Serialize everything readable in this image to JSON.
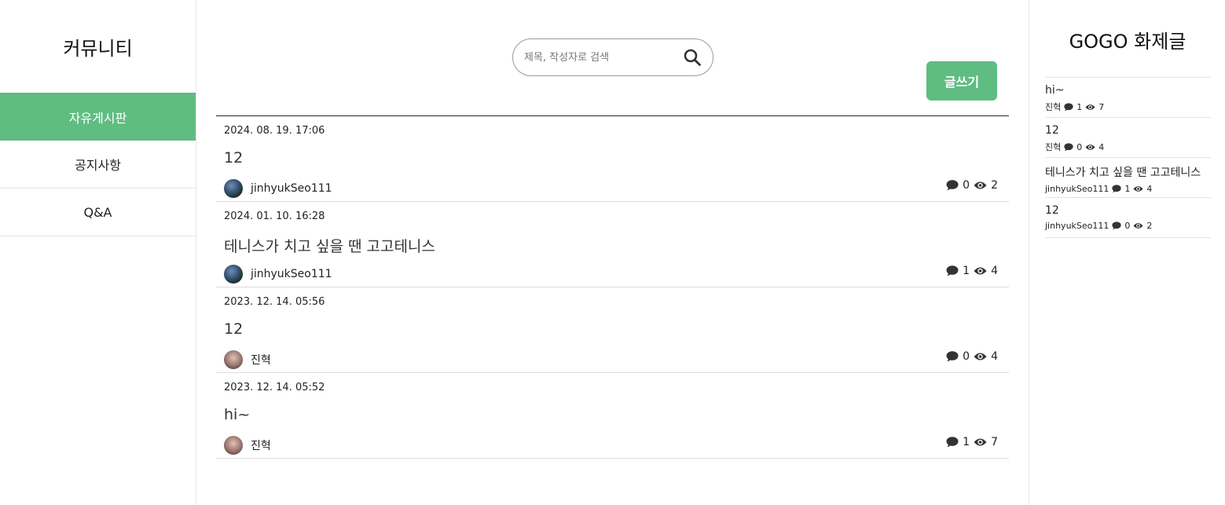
{
  "sidebar": {
    "title": "커뮤니티",
    "items": [
      {
        "label": "자유게시판",
        "active": true
      },
      {
        "label": "공지사항",
        "active": false
      },
      {
        "label": "Q&A",
        "active": false
      }
    ]
  },
  "search": {
    "placeholder": "제목, 작성자로 검색",
    "icon": "search-icon"
  },
  "write_button": {
    "label": "글쓰기"
  },
  "posts": [
    {
      "date": "2024. 08. 19. 17:06",
      "title": "12",
      "author": "jinhyukSeo111",
      "avatar": "landscape",
      "comments": "0",
      "views": "2"
    },
    {
      "date": "2024. 01. 10. 16:28",
      "title": "테니스가 치고 싶을 땐 고고테니스",
      "author": "jinhyukSeo111",
      "avatar": "landscape",
      "comments": "1",
      "views": "4"
    },
    {
      "date": "2023. 12. 14. 05:56",
      "title": "12",
      "author": "진혁",
      "avatar": "person",
      "comments": "0",
      "views": "4"
    },
    {
      "date": "2023. 12. 14. 05:52",
      "title": "hi~",
      "author": "진혁",
      "avatar": "person",
      "comments": "1",
      "views": "7"
    }
  ],
  "hot": {
    "title": "GOGO 화제글",
    "items": [
      {
        "title": "hi~",
        "author": "진혁",
        "comments": "1",
        "views": "7"
      },
      {
        "title": "12",
        "author": "진혁",
        "comments": "0",
        "views": "4"
      },
      {
        "title": "테니스가 치고 싶을 땐 고고테니스",
        "author": "jinhyukSeo111",
        "comments": "1",
        "views": "4"
      },
      {
        "title": "12",
        "author": "jinhyukSeo111",
        "comments": "0",
        "views": "2"
      }
    ]
  },
  "colors": {
    "accent": "#5fbd82",
    "text": "#222222",
    "divider": "#dcdcdc"
  }
}
